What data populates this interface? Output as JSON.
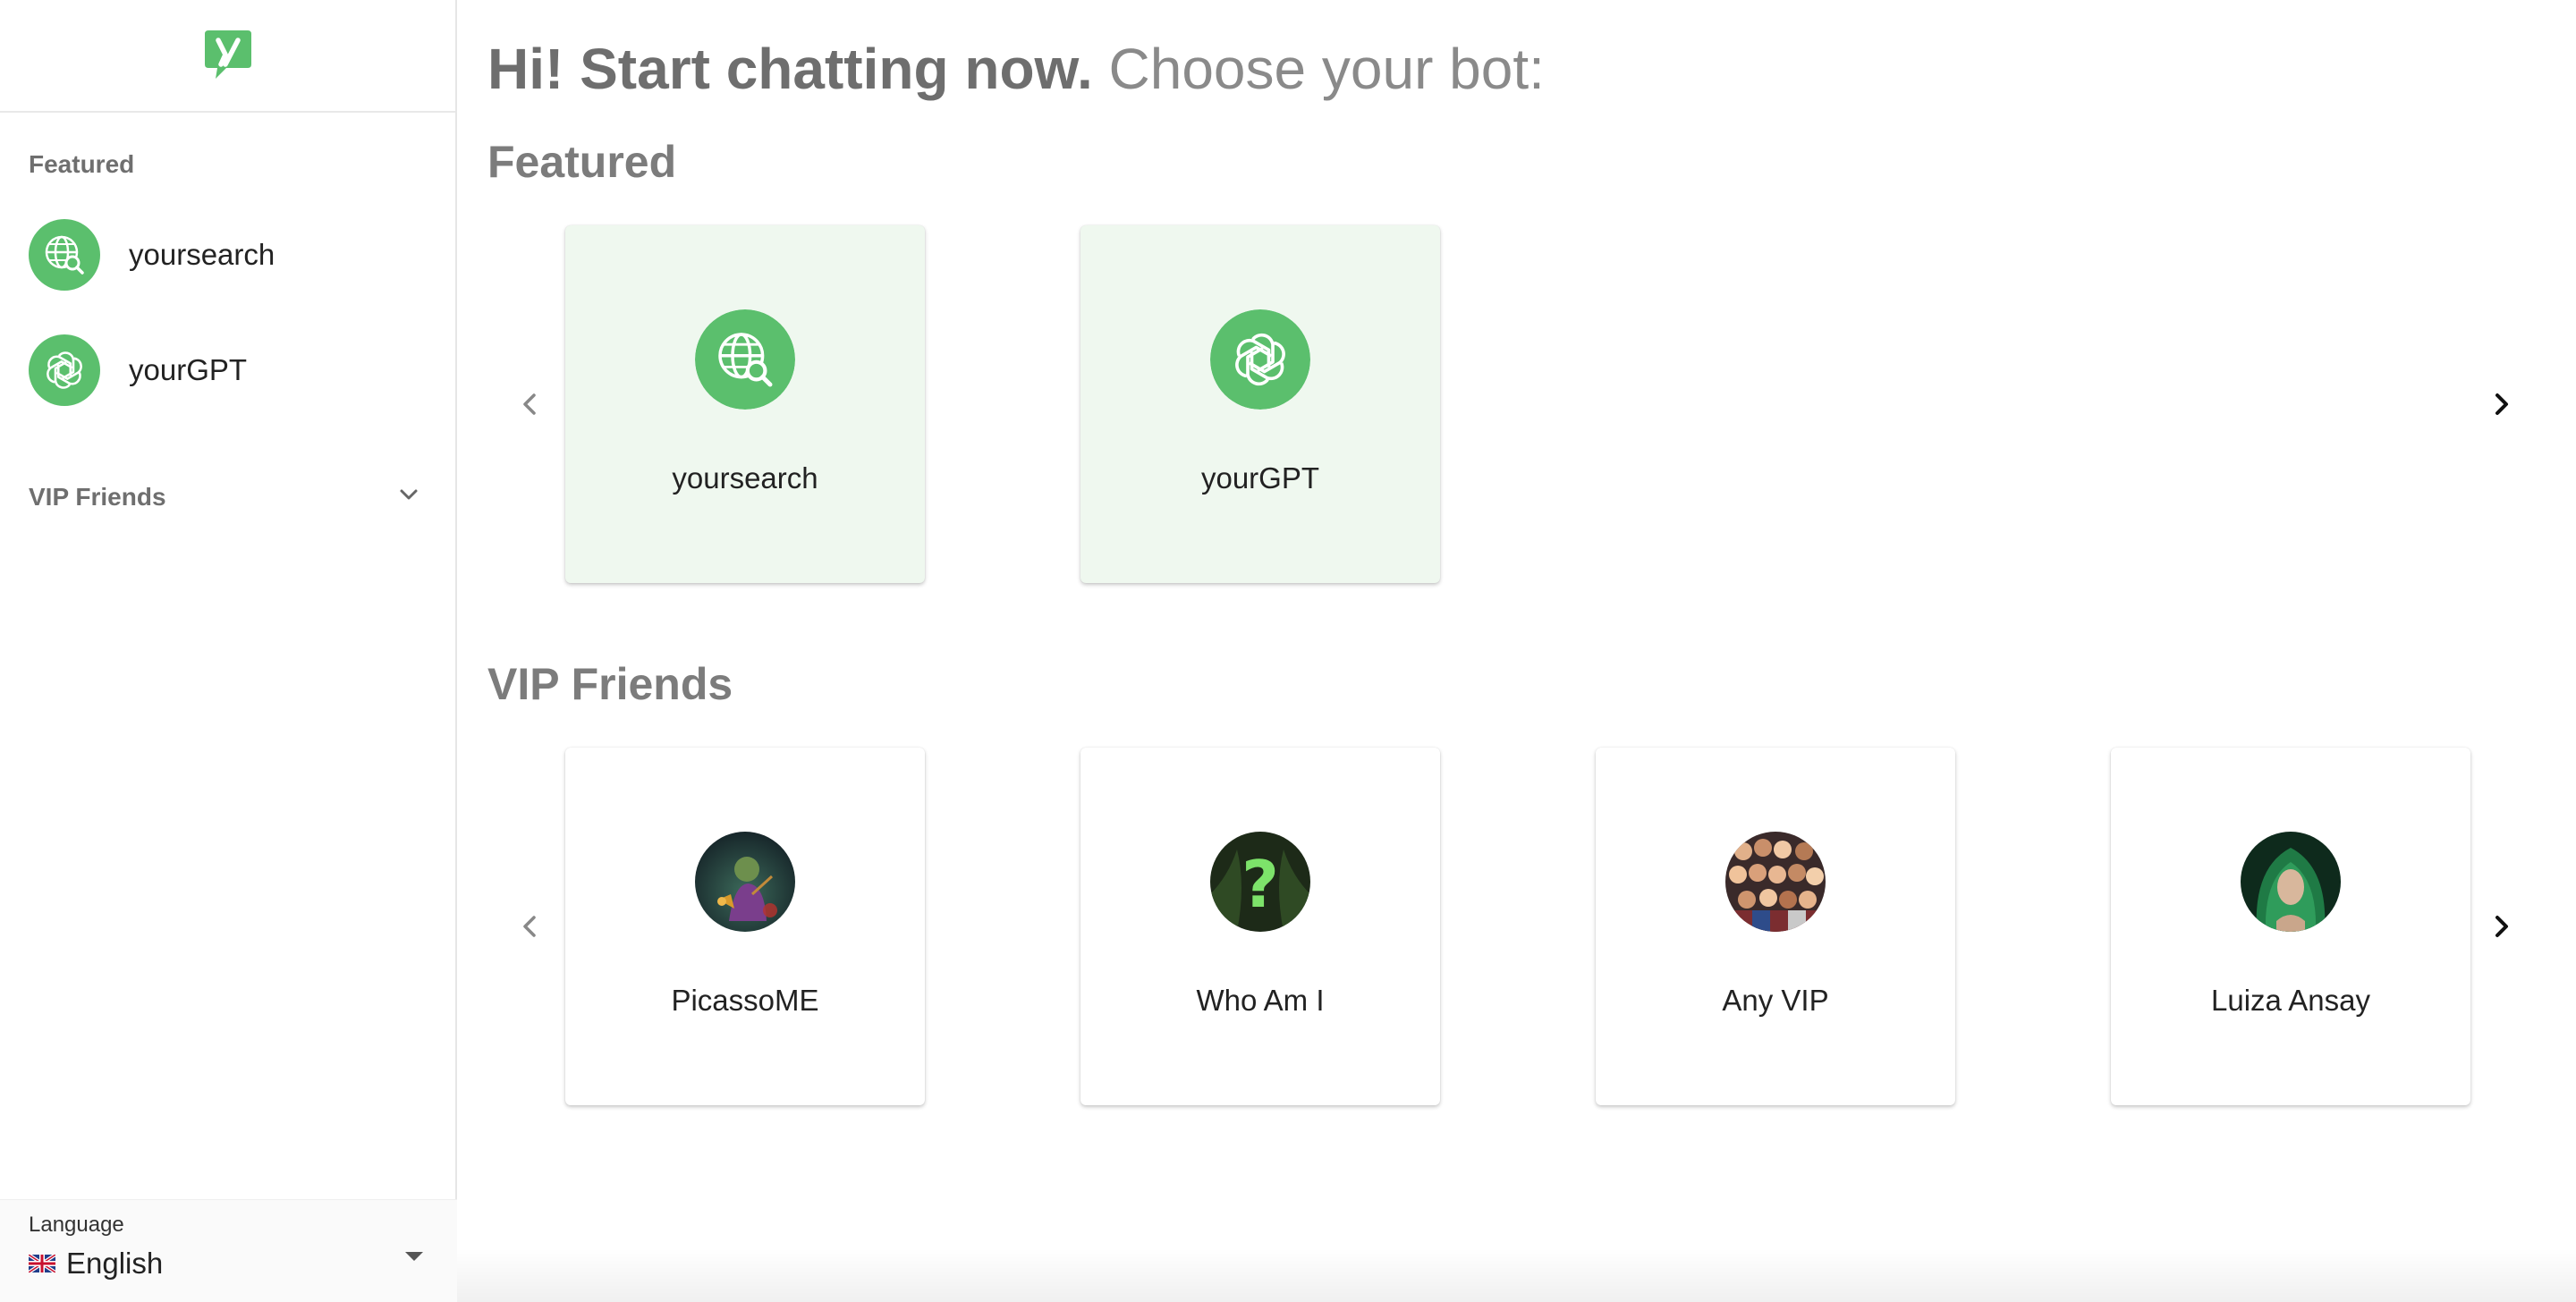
{
  "sidebar": {
    "featured_title": "Featured",
    "featured_items": [
      {
        "label": "yoursearch",
        "icon": "globe-search-icon"
      },
      {
        "label": "yourGPT",
        "icon": "openai-knot-icon"
      }
    ],
    "vip_title": "VIP Friends",
    "language": {
      "caption": "Language",
      "value": "English",
      "flag": "uk-flag-icon"
    }
  },
  "main": {
    "headline_bold": "Hi! Start chatting now.",
    "headline_light": "Choose your bot:",
    "featured_title": "Featured",
    "featured_cards": [
      {
        "name": "yoursearch",
        "icon": "globe-search-icon"
      },
      {
        "name": "yourGPT",
        "icon": "openai-knot-icon"
      }
    ],
    "vip_title": "VIP Friends",
    "vip_cards": [
      {
        "name": "PicassoME",
        "icon": "painter-avatar"
      },
      {
        "name": "Who Am I",
        "icon": "question-mark-avatar"
      },
      {
        "name": "Any VIP",
        "icon": "crowd-avatar"
      },
      {
        "name": "Luiza Ansay",
        "icon": "green-hood-avatar"
      }
    ]
  },
  "colors": {
    "brand_green": "#5bbf6d",
    "featured_card_bg": "#eff8ef"
  }
}
